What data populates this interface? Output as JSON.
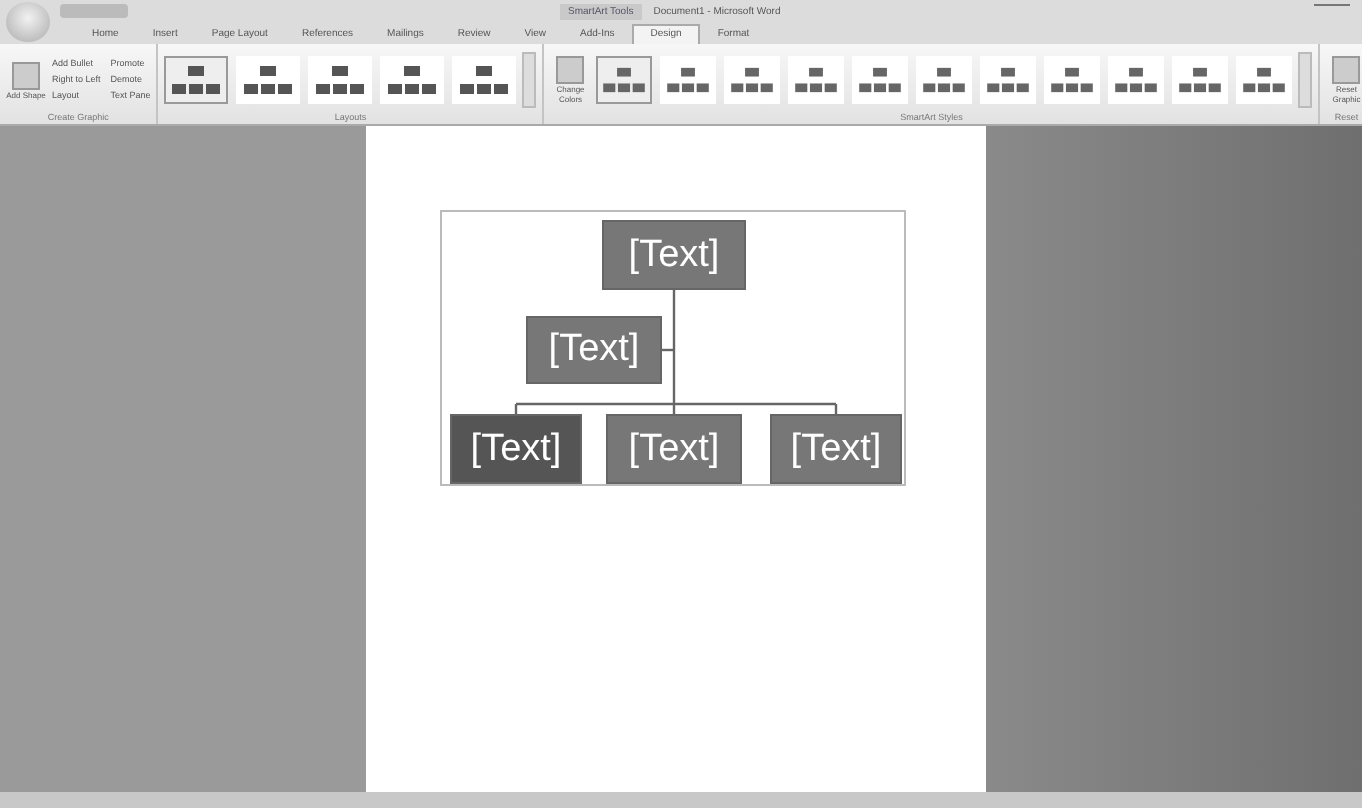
{
  "window": {
    "title": "Document1 - Microsoft Word",
    "context_tab_group": "SmartArt Tools"
  },
  "tabs": [
    {
      "label": "Home",
      "selected": false
    },
    {
      "label": "Insert",
      "selected": false
    },
    {
      "label": "Page Layout",
      "selected": false
    },
    {
      "label": "References",
      "selected": false
    },
    {
      "label": "Mailings",
      "selected": false
    },
    {
      "label": "Review",
      "selected": false
    },
    {
      "label": "View",
      "selected": false
    },
    {
      "label": "Add-Ins",
      "selected": false
    },
    {
      "label": "Design",
      "selected": true
    },
    {
      "label": "Format",
      "selected": false
    }
  ],
  "ribbon_groups": [
    {
      "kind": "create",
      "label": "Create Graphic",
      "big": "Add Shape",
      "commands": [
        "Add Bullet",
        "Right to Left",
        "Layout",
        "Promote",
        "Demote",
        "Text Pane"
      ]
    },
    {
      "kind": "gallery",
      "label": "Layouts",
      "items": [
        {
          "selected": true
        },
        {
          "selected": false
        },
        {
          "selected": false
        },
        {
          "selected": false
        },
        {
          "selected": false
        }
      ]
    },
    {
      "kind": "styles",
      "label": "SmartArt Styles",
      "big": "Change Colors",
      "items": [
        {
          "selected": true
        },
        {
          "selected": false
        },
        {
          "selected": false
        },
        {
          "selected": false
        },
        {
          "selected": false
        },
        {
          "selected": false
        },
        {
          "selected": false
        },
        {
          "selected": false
        },
        {
          "selected": false
        },
        {
          "selected": false
        },
        {
          "selected": false
        }
      ]
    },
    {
      "kind": "reset",
      "label": "Reset",
      "big": "Reset Graphic"
    }
  ],
  "smartart": {
    "text": "[Text]",
    "assistant": {
      "text": "[Text]"
    },
    "children": [
      {
        "text": "[Text]"
      },
      {
        "text": "[Text]"
      },
      {
        "text": "[Text]"
      }
    ]
  }
}
